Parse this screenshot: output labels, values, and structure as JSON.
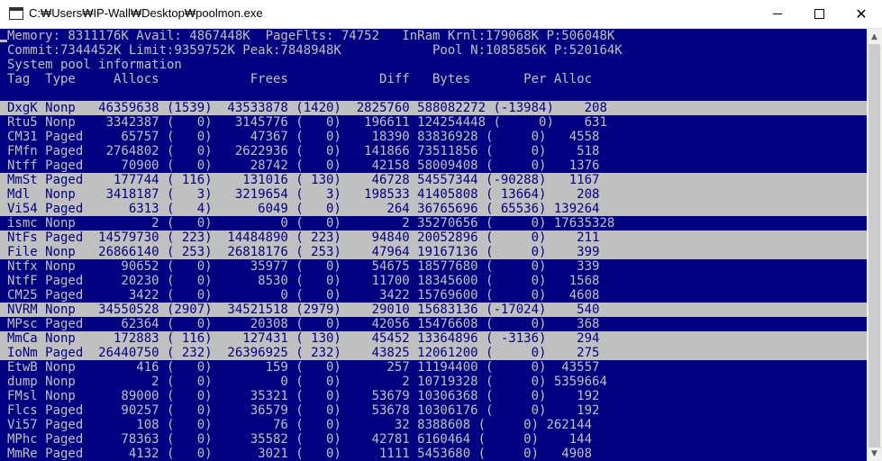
{
  "window": {
    "title": "C:₩Users₩IP-Wall₩Desktop₩poolmon.exe",
    "minimize_icon": "minimize-icon",
    "maximize_icon": "maximize-icon",
    "close_icon": "close-icon",
    "close_glyph": "✕"
  },
  "colors": {
    "console_bg": "#000080",
    "console_fg": "#c0c0c0",
    "highlight_bg": "#c0c0c0",
    "highlight_fg": "#000080"
  },
  "header": [
    "Memory: 8311176K Avail: 4867448K  PageFlts: 74752   InRam Krnl:179068K P:506048K",
    "Commit:7344452K Limit:9359752K Peak:7848948K            Pool N:1085856K P:520164K",
    "System pool information",
    "Tag  Type     Allocs            Frees            Diff   Bytes       Per Alloc"
  ],
  "rows": [
    {
      "text": "DxgK Nonp   46359638 (1539)  43533878 (1420)  2825760 588082272 (-13984)    208",
      "highlighted": true
    },
    {
      "text": "Rtu5 Nonp    3342387 (   0)   3145776 (   0)   196611 124254448 (     0)    631",
      "highlighted": false
    },
    {
      "text": "CM31 Paged     65757 (   0)     47367 (   0)    18390 83836928 (     0)   4558",
      "highlighted": false
    },
    {
      "text": "FMfn Paged   2764802 (   0)   2622936 (   0)   141866 73511856 (     0)    518",
      "highlighted": false
    },
    {
      "text": "Ntff Paged     70900 (   0)     28742 (   0)    42158 58009408 (     0)   1376",
      "highlighted": false
    },
    {
      "text": "MmSt Paged    177744 ( 116)    131016 ( 130)    46728 54557344 (-90288)   1167",
      "highlighted": true
    },
    {
      "text": "Mdl  Nonp    3418187 (   3)   3219654 (   3)   198533 41405808 ( 13664)    208",
      "highlighted": true
    },
    {
      "text": "Vi54 Paged      6313 (   4)      6049 (   0)      264 36765696 ( 65536) 139264",
      "highlighted": true
    },
    {
      "text": "ismc Nonp          2 (   0)         0 (   0)        2 35270656 (     0) 17635328",
      "highlighted": false
    },
    {
      "text": "NtFs Paged  14579730 ( 223)  14484890 ( 223)    94840 20052896 (     0)    211",
      "highlighted": true
    },
    {
      "text": "File Nonp   26866140 ( 253)  26818176 ( 253)    47964 19167136 (     0)    399",
      "highlighted": true
    },
    {
      "text": "Ntfx Nonp      90652 (   0)     35977 (   0)    54675 18577680 (     0)    339",
      "highlighted": false
    },
    {
      "text": "NtfF Paged     20230 (   0)      8530 (   0)    11700 18345600 (     0)   1568",
      "highlighted": false
    },
    {
      "text": "CM25 Paged      3422 (   0)         0 (   0)     3422 15769600 (     0)   4608",
      "highlighted": false
    },
    {
      "text": "NVRM Nonp   34550528 (2907)  34521518 (2979)    29010 15683136 (-17024)    540",
      "highlighted": true
    },
    {
      "text": "MPsc Paged     62364 (   0)     20308 (   0)    42056 15476608 (     0)    368",
      "highlighted": false
    },
    {
      "text": "MmCa Nonp     172883 ( 116)    127431 ( 130)    45452 13364896 ( -3136)    294",
      "highlighted": true
    },
    {
      "text": "IoNm Paged  26440750 ( 232)  26396925 ( 232)    43825 12061200 (     0)    275",
      "highlighted": true
    },
    {
      "text": "EtwB Nonp        416 (   0)       159 (   0)      257 11194400 (     0)  43557",
      "highlighted": false
    },
    {
      "text": "dump Nonp          2 (   0)         0 (   0)        2 10719328 (     0) 5359664",
      "highlighted": false
    },
    {
      "text": "FMsl Nonp      89000 (   0)     35321 (   0)    53679 10306368 (     0)    192",
      "highlighted": false
    },
    {
      "text": "Flcs Paged     90257 (   0)     36579 (   0)    53678 10306176 (     0)    192",
      "highlighted": false
    },
    {
      "text": "Vi57 Paged       108 (   0)        76 (   0)       32 8388608 (     0) 262144",
      "highlighted": false
    },
    {
      "text": "MPhc Paged     78363 (   0)     35582 (   0)    42781 6160464 (     0)    144",
      "highlighted": false
    },
    {
      "text": "MmRe Paged      4132 (   0)      3021 (   0)     1111 5453680 (     0)   4908",
      "highlighted": false
    }
  ],
  "scrollbar": {
    "up_icon": "scroll-up-arrow-icon",
    "down_icon": "scroll-down-arrow-icon"
  }
}
